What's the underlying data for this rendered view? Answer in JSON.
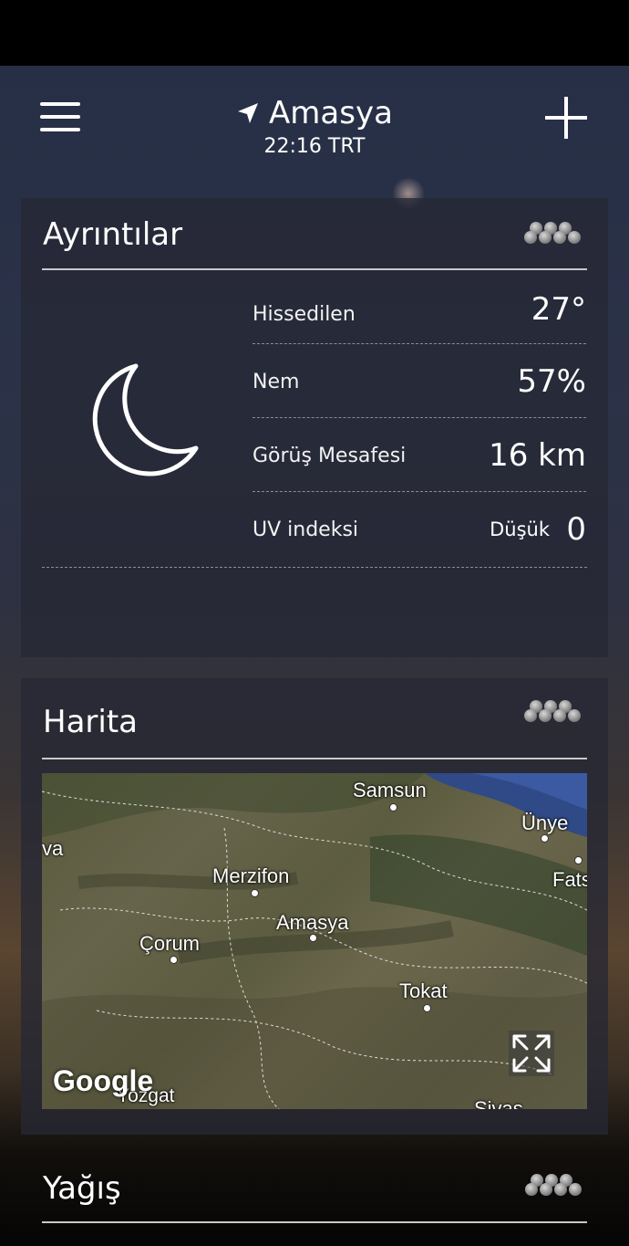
{
  "header": {
    "city": "Amasya",
    "time": "22:16 TRT",
    "menu_icon": "hamburger-menu-icon",
    "location_icon": "location-arrow-icon",
    "add_icon": "plus-icon"
  },
  "details": {
    "title": "Ayrıntılar",
    "condition_icon": "moon-icon",
    "rows": [
      {
        "label": "Hissedilen",
        "value": "27°"
      },
      {
        "label": "Nem",
        "value": "57%"
      },
      {
        "label": "Görüş Mesafesi",
        "value": "16 km"
      },
      {
        "label": "UV indeksi",
        "sub": "Düşük",
        "value": "0"
      }
    ]
  },
  "map": {
    "title": "Harita",
    "labels": [
      "Samsun",
      "Ünye",
      "Merzifon",
      "Fats",
      "Amasya",
      "Çorum",
      "Tokat",
      "Yozgat",
      "Sivas",
      "va"
    ],
    "attribution": "Google",
    "expand_icon": "expand-icon"
  },
  "precipitation": {
    "title": "Yağış"
  },
  "colors": {
    "background_top": "#262f46",
    "card": "#26283a",
    "text": "#ffffff"
  }
}
